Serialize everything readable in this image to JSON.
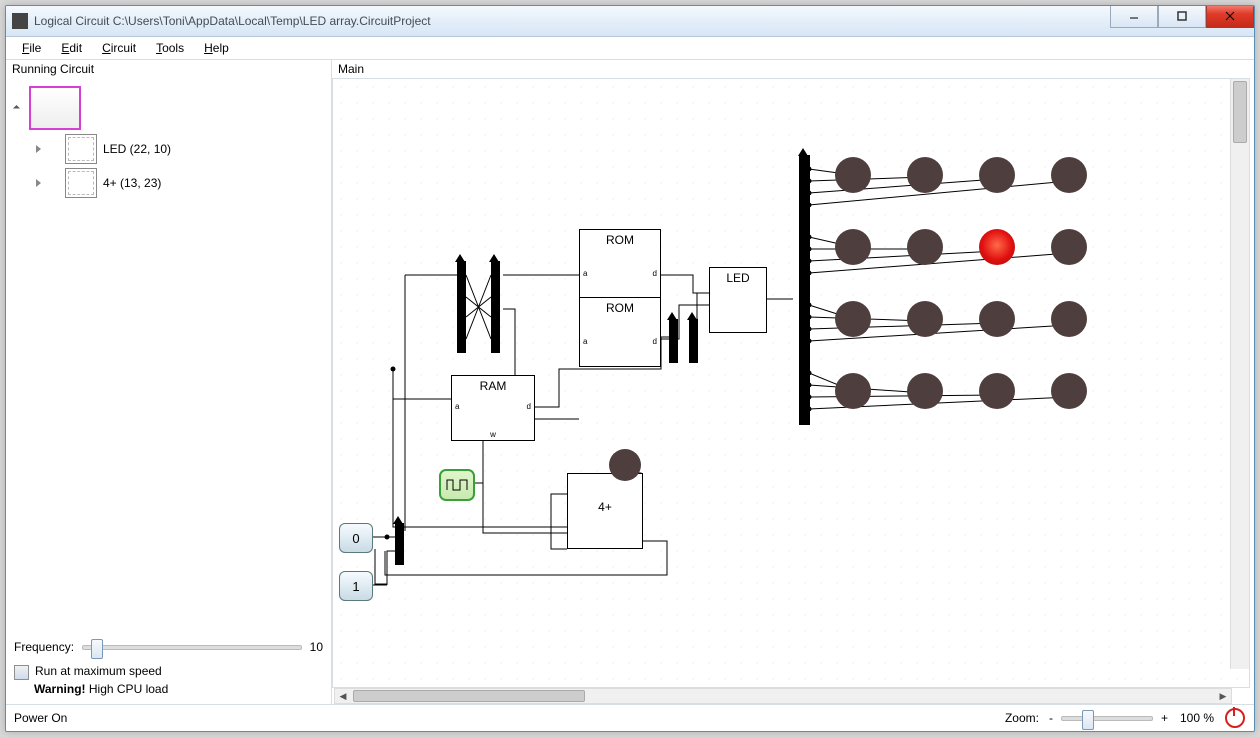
{
  "window": {
    "title": "Logical Circuit C:\\Users\\Toni\\AppData\\Local\\Temp\\LED array.CircuitProject"
  },
  "menu": {
    "file": "File",
    "edit": "Edit",
    "circuit": "Circuit",
    "tools": "Tools",
    "help": "Help"
  },
  "sidebar": {
    "header": "Running Circuit",
    "items": [
      {
        "label": ""
      },
      {
        "label": "LED  (22, 10)"
      },
      {
        "label": "4+  (13, 23)"
      }
    ],
    "frequency": {
      "label": "Frequency:",
      "value": "10"
    },
    "run_max": {
      "label": "Run at maximum speed"
    },
    "warning": {
      "bold": "Warning!",
      "rest": " High CPU load"
    }
  },
  "main": {
    "header": "Main",
    "blocks": {
      "rom1": "ROM",
      "rom2": "ROM",
      "ram": "RAM",
      "led": "LED",
      "counter": "4+",
      "const0": "0",
      "const1": "1",
      "rom_a": "a",
      "rom_d": "d",
      "ram_a": "a",
      "ram_d": "d",
      "ram_w": "w"
    }
  },
  "status": {
    "power": "Power On",
    "zoom_label": "Zoom:",
    "zoom_value": "100 %",
    "zoom_minus": "-",
    "zoom_plus": "+"
  }
}
